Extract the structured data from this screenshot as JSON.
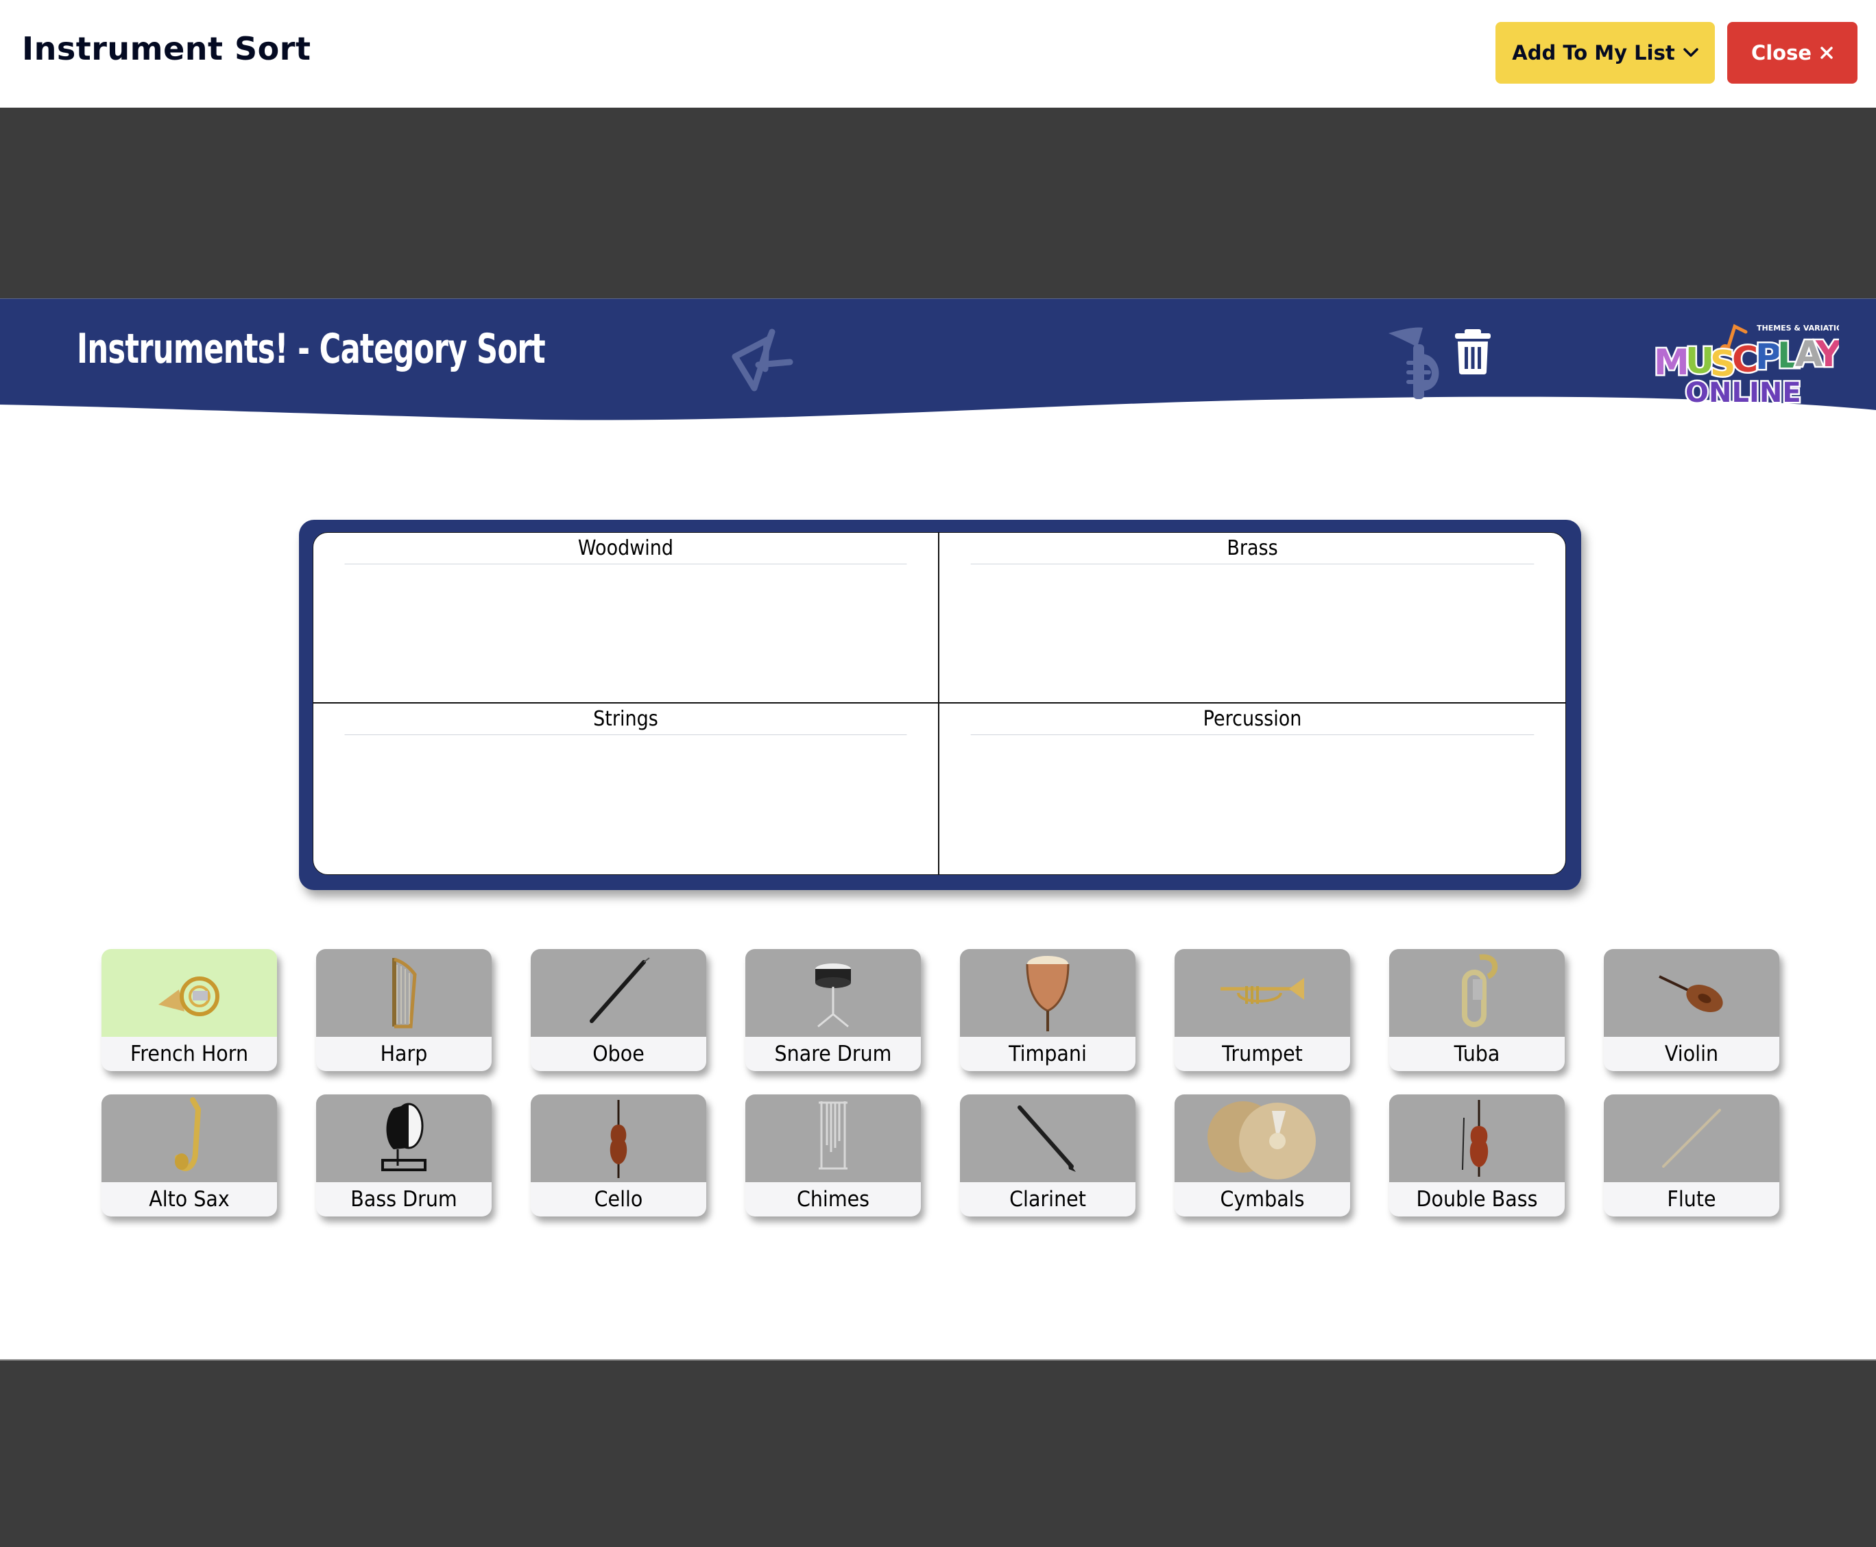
{
  "header": {
    "title": "Instrument Sort",
    "add_to_list_label": "Add To My List",
    "close_label": "Close"
  },
  "activity": {
    "title": "Instruments! - Category Sort",
    "logo": {
      "tagline": "THEMES & VARIATIONS",
      "line1": "MUSICPLAY",
      "line2": "ONLINE"
    }
  },
  "board": {
    "categories": [
      {
        "label": "Woodwind"
      },
      {
        "label": "Brass"
      },
      {
        "label": "Strings"
      },
      {
        "label": "Percussion"
      }
    ]
  },
  "cards": [
    {
      "label": "French Horn",
      "icon": "french-horn-image",
      "selected": true
    },
    {
      "label": "Harp",
      "icon": "harp-image"
    },
    {
      "label": "Oboe",
      "icon": "oboe-image"
    },
    {
      "label": "Snare Drum",
      "icon": "snare-drum-image"
    },
    {
      "label": "Timpani",
      "icon": "timpani-image"
    },
    {
      "label": "Trumpet",
      "icon": "trumpet-image"
    },
    {
      "label": "Tuba",
      "icon": "tuba-image"
    },
    {
      "label": "Violin",
      "icon": "violin-image"
    },
    {
      "label": "Alto Sax",
      "icon": "alto-sax-image"
    },
    {
      "label": "Bass Drum",
      "icon": "bass-drum-image"
    },
    {
      "label": "Cello",
      "icon": "cello-image"
    },
    {
      "label": "Chimes",
      "icon": "chimes-image"
    },
    {
      "label": "Clarinet",
      "icon": "clarinet-image"
    },
    {
      "label": "Cymbals",
      "icon": "cymbals-image"
    },
    {
      "label": "Double Bass",
      "icon": "double-bass-image"
    },
    {
      "label": "Flute",
      "icon": "flute-image"
    }
  ],
  "colors": {
    "navy": "#263776",
    "add_button": "#f5d44a",
    "close_button": "#d93a33",
    "selected_card": "#d7f2b8",
    "card_image_bg": "#a6a6a6"
  }
}
